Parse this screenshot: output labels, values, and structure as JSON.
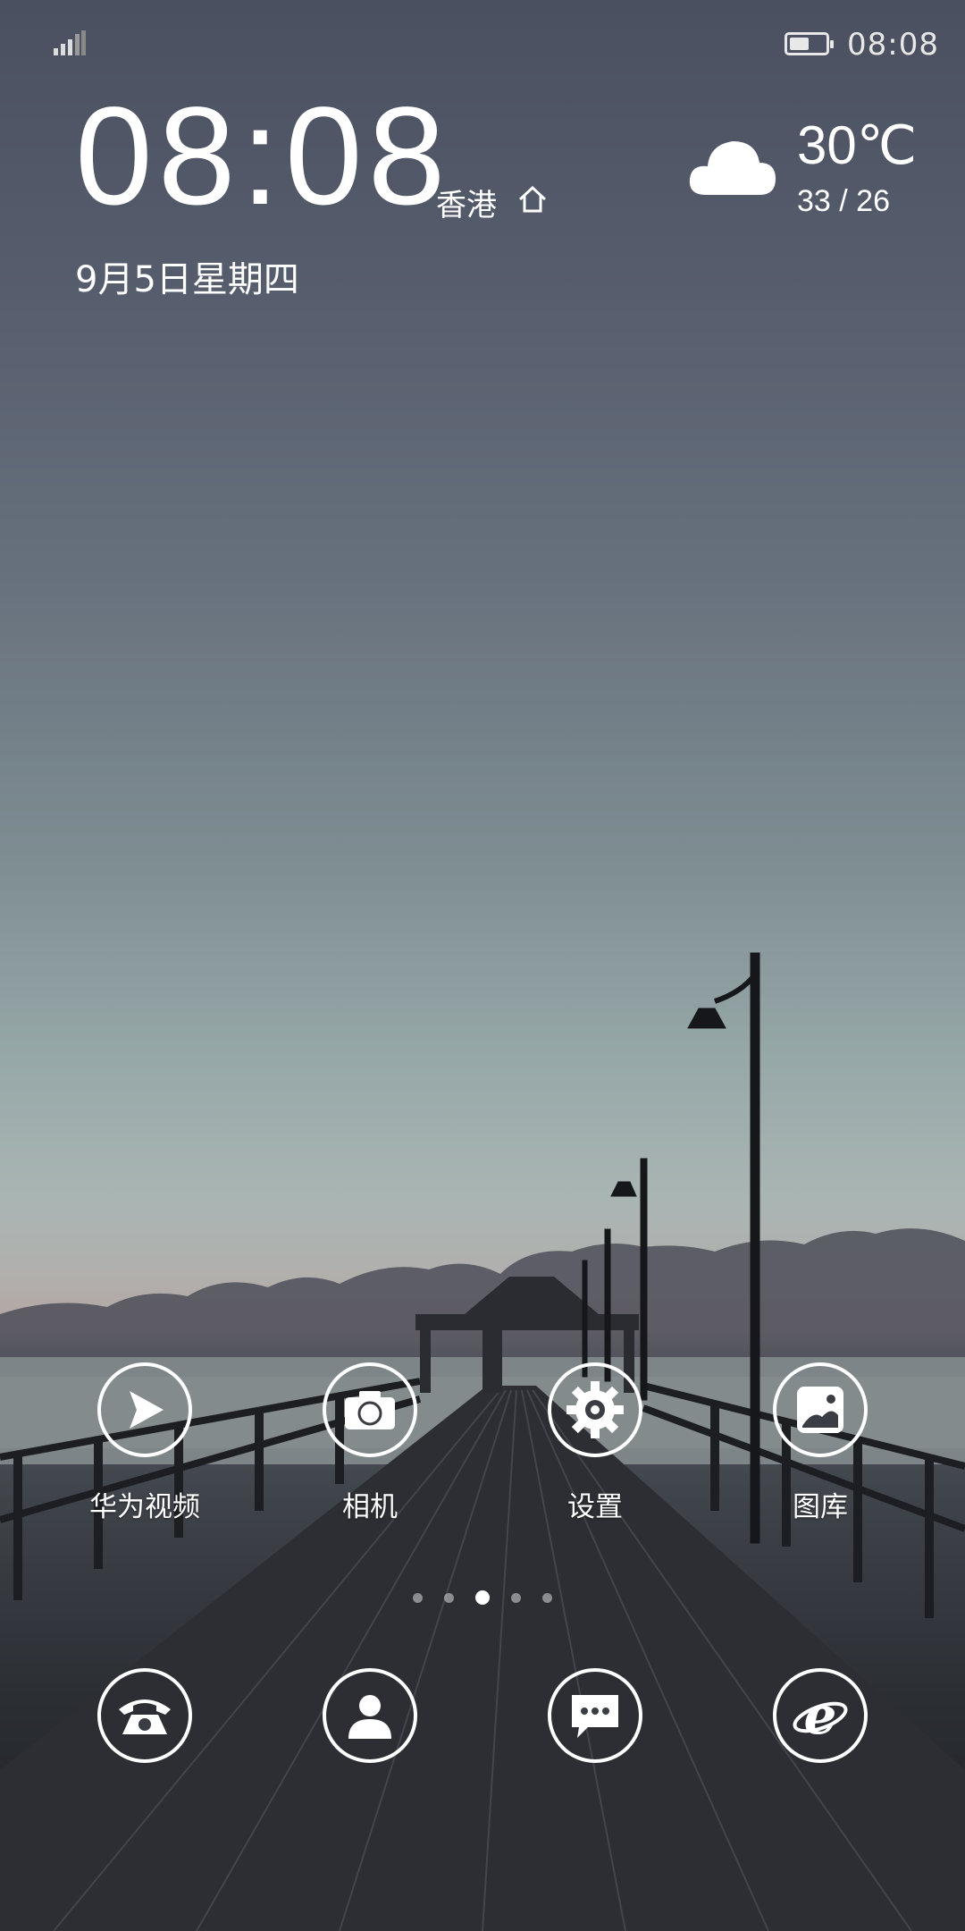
{
  "status_bar": {
    "time": "08:08",
    "battery_level": 0.55
  },
  "clock": {
    "hour": "08",
    "sep": ":",
    "minute": "08",
    "city": "香港",
    "date": "9月5日星期四"
  },
  "weather": {
    "icon": "cloud-icon",
    "temp": "30℃",
    "range": "33 / 26"
  },
  "apps": [
    {
      "name": "华为视频",
      "icon": "video-play-icon"
    },
    {
      "name": "相机",
      "icon": "camera-icon"
    },
    {
      "name": "设置",
      "icon": "gear-icon"
    },
    {
      "name": "图库",
      "icon": "gallery-icon"
    }
  ],
  "page_indicator": {
    "count": 5,
    "active": 3
  },
  "dock": [
    {
      "icon": "phone-icon"
    },
    {
      "icon": "contacts-icon"
    },
    {
      "icon": "messages-icon"
    },
    {
      "icon": "browser-icon"
    }
  ],
  "colors": {
    "sky_top": "#4a5060",
    "horizon": "#b4a4a1",
    "pier": "#2b2e33"
  }
}
